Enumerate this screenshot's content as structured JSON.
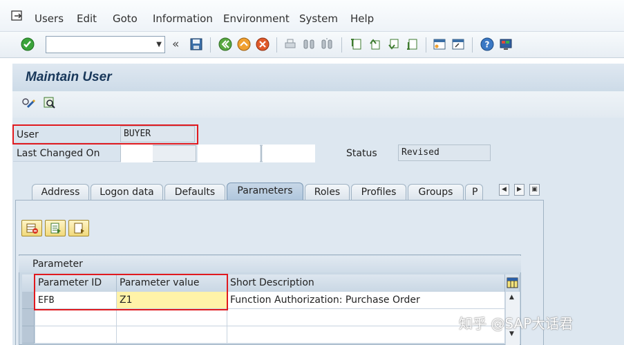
{
  "menu": {
    "items": [
      {
        "label": "Users"
      },
      {
        "label": "Edit"
      },
      {
        "label": "Goto"
      },
      {
        "label": "Information"
      },
      {
        "label": "Environment"
      },
      {
        "label": "System"
      },
      {
        "label": "Help"
      }
    ]
  },
  "toolbar": {
    "command_field": {
      "value": "",
      "placeholder": ""
    }
  },
  "page": {
    "title": "Maintain User"
  },
  "header_fields": {
    "user_label": "User",
    "user_value": "BUYER",
    "last_changed_label": "Last Changed On",
    "status_label": "Status",
    "status_value": "Revised"
  },
  "tabs": [
    {
      "label": "Address",
      "active": false
    },
    {
      "label": "Logon data",
      "active": false
    },
    {
      "label": "Defaults",
      "active": false
    },
    {
      "label": "Parameters",
      "active": true
    },
    {
      "label": "Roles",
      "active": false
    },
    {
      "label": "Profiles",
      "active": false
    },
    {
      "label": "Groups",
      "active": false
    },
    {
      "label": "P",
      "active": false
    }
  ],
  "parameters": {
    "title": "Parameter",
    "columns": [
      "Parameter ID",
      "Parameter value",
      "Short Description"
    ],
    "rows": [
      {
        "id": "EFB",
        "value": "Z1",
        "description": "Function Authorization: Purchase Order"
      }
    ]
  },
  "watermark": "知乎 @SAP大话君",
  "colors": {
    "highlight_box": "#e0191e",
    "title_bar": "#cddbe8",
    "active_tab": "#aec5dc",
    "selected_cell": "#fff3a8"
  }
}
